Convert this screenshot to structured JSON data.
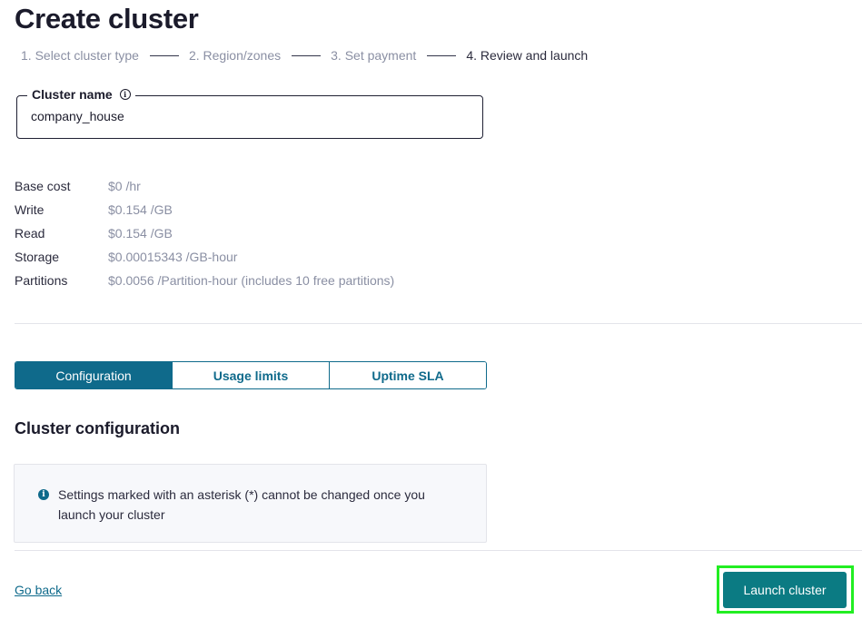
{
  "page": {
    "title": "Create cluster"
  },
  "steps": [
    {
      "label": "1. Select cluster type"
    },
    {
      "label": "2. Region/zones"
    },
    {
      "label": "3. Set payment"
    },
    {
      "label": "4. Review and launch"
    }
  ],
  "cluster_name": {
    "label": "Cluster name",
    "info_icon": "info-icon",
    "value": "company_house"
  },
  "costs": [
    {
      "label": "Base cost",
      "value": "$0 /hr"
    },
    {
      "label": "Write",
      "value": "$0.154 /GB"
    },
    {
      "label": "Read",
      "value": "$0.154 /GB"
    },
    {
      "label": "Storage",
      "value": "$0.00015343 /GB-hour"
    },
    {
      "label": "Partitions",
      "value": "$0.0056 /Partition-hour (includes 10 free partitions)"
    }
  ],
  "tabs": [
    {
      "label": "Configuration",
      "active": true
    },
    {
      "label": "Usage limits",
      "active": false
    },
    {
      "label": "Uptime SLA",
      "active": false
    }
  ],
  "section": {
    "title": "Cluster configuration",
    "notice": "Settings marked with an asterisk (*) cannot be changed once you launch your cluster",
    "notice_icon": "info-icon"
  },
  "footer": {
    "back_label": "Go back",
    "launch_label": "Launch cluster"
  },
  "colors": {
    "accent": "#0f6a8b",
    "launch_button": "#0b7b83",
    "highlight": "#22ee22"
  }
}
